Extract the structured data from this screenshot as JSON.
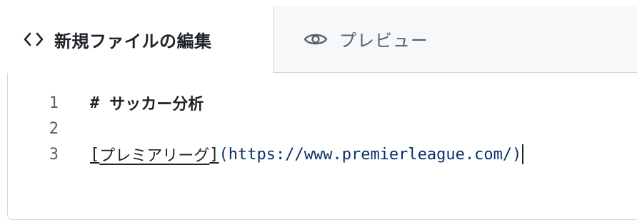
{
  "tabs": {
    "edit": {
      "label": "新規ファイルの編集",
      "icon": "code-icon"
    },
    "preview": {
      "label": "プレビュー",
      "icon": "eye-icon"
    }
  },
  "editor": {
    "lines": [
      {
        "number": "1",
        "heading_mark": "#",
        "heading_text": "サッカー分析"
      },
      {
        "number": "2"
      },
      {
        "number": "3",
        "link_open": "[",
        "link_text": "プレミアリーグ",
        "link_close": "]",
        "url": "(https://www.premierleague.com/)"
      }
    ]
  },
  "colors": {
    "border": "#d0d7de",
    "inactive_tab_bg": "#f6f8fa",
    "text": "#1f2328",
    "muted": "#57606a",
    "url": "#0a3069"
  }
}
